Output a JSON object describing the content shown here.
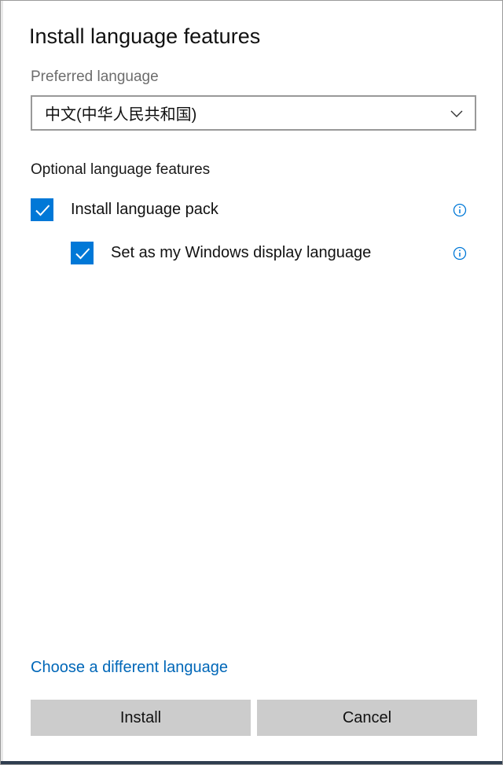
{
  "dialog": {
    "title": "Install language features"
  },
  "preferred_language": {
    "label": "Preferred language",
    "selected": "中文(中华人民共和国)",
    "chevron_icon": "chevron-down-icon"
  },
  "optional_features": {
    "heading": "Optional language features",
    "items": [
      {
        "label": "Install language pack",
        "checked": true,
        "info_icon": "info-icon"
      },
      {
        "label": "Set as my Windows display language",
        "checked": true,
        "info_icon": "info-icon"
      }
    ]
  },
  "link": {
    "label": "Choose a different language"
  },
  "buttons": {
    "install": "Install",
    "cancel": "Cancel"
  },
  "colors": {
    "accent": "#0078d7",
    "link": "#0067b8",
    "button_bg": "#cccccc",
    "secondary_text": "#6d6d6d"
  }
}
